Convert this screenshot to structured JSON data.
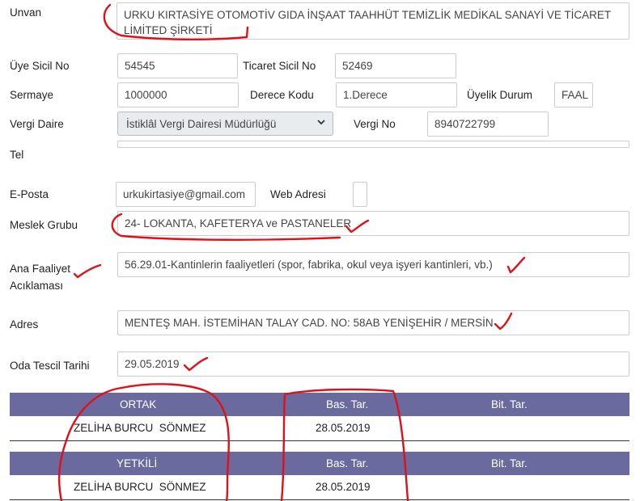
{
  "form": {
    "unvan": {
      "label": "Unvan",
      "value": "URKU KIRTASİYE OTOMOTİV GIDA İNŞAAT TAAHHÜT TEMİZLİK MEDİKAL SANAYİ VE TİCARET LİMİTED ŞİRKETİ"
    },
    "uye_sicil_no": {
      "label": "Üye Sicil No",
      "value": "54545"
    },
    "ticaret_sicil_no": {
      "label": "Ticaret Sicil No",
      "value": "52469"
    },
    "sermaye": {
      "label": "Sermaye",
      "value": "1000000"
    },
    "derece_kodu": {
      "label": "Derece Kodu",
      "value": "1.Derece"
    },
    "uyelik_durum": {
      "label": "Üyelik Durum",
      "value": "FAAL"
    },
    "vergi_daire": {
      "label": "Vergi Daire",
      "value": "İstiklâl Vergi Dairesi Müdürlüğü"
    },
    "vergi_no": {
      "label": "Vergi No",
      "value": "8940722799"
    },
    "tel": {
      "label": "Tel",
      "value": ""
    },
    "e_posta": {
      "label": "E-Posta",
      "value": "urkukirtasiye@gmail.com"
    },
    "web_adresi": {
      "label": "Web Adresi",
      "value": ""
    },
    "meslek_grubu": {
      "label": "Meslek Grubu",
      "value": "24- LOKANTA, KAFETERYA ve PASTANELER"
    },
    "ana_faaliyet": {
      "label_line1": "Ana Faaliyet",
      "label_line2": "Acıklaması",
      "value": "56.29.01-Kantinlerin faaliyetleri (spor, fabrika, okul veya işyeri kantinleri, vb.)"
    },
    "adres": {
      "label": "Adres",
      "value": "MENTEŞ MAH. İSTEMİHAN TALAY CAD. NO: 58AB YENİŞEHİR / MERSİN"
    },
    "oda_tescil_tarihi": {
      "label": "Oda Tescil Tarihi",
      "value": "29.05.2019"
    }
  },
  "ortak_table": {
    "headers": [
      "ORTAK",
      "Bas. Tar.",
      "Bit. Tar."
    ],
    "rows": [
      {
        "name": "ZELİHA BURCU  SÖNMEZ",
        "bas": "28.05.2019",
        "bit": ""
      }
    ]
  },
  "yetkili_table": {
    "headers": [
      "YETKİLİ",
      "Bas. Tar.",
      "Bit. Tar."
    ],
    "rows": [
      {
        "name": "ZELİHA BURCU  SÖNMEZ",
        "bas": "28.05.2019",
        "bit": ""
      }
    ]
  },
  "colors": {
    "table_header": "#6a6a9e",
    "annotation": "#e0101a"
  },
  "icons": {
    "select_arrow": "chevron-down-icon"
  }
}
